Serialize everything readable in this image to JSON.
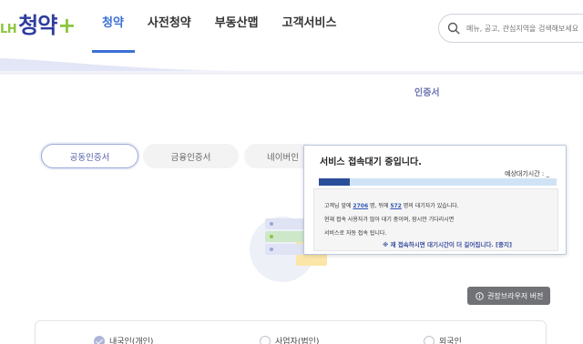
{
  "header": {
    "logo": {
      "prefix": "LH",
      "name": "청약",
      "plus": "+"
    },
    "nav": [
      {
        "label": "청약",
        "active": true
      },
      {
        "label": "사전청약",
        "active": false
      },
      {
        "label": "부동산맵",
        "active": false
      },
      {
        "label": "고객서비스",
        "active": false
      }
    ],
    "search": {
      "placeholder": "메뉴, 공고, 관심지역을 검색해보세요"
    }
  },
  "section": {
    "title": "인증서"
  },
  "cert_tabs": [
    {
      "label": "공동인증서",
      "selected": true
    },
    {
      "label": "금융인증서",
      "selected": false
    },
    {
      "label": "네이버인",
      "selected": false
    }
  ],
  "browser_button": {
    "label": "권장브라우저 버전",
    "icon": "info-icon"
  },
  "user_types": [
    {
      "label": "내국인(개인)",
      "checked": true
    },
    {
      "label": "사업자(법인)",
      "checked": false
    },
    {
      "label": "외국인",
      "checked": false
    }
  ],
  "wait_modal": {
    "title": "서비스 접속대기 중입니다.",
    "expected_label": "예상대기시간 : _",
    "progress": 0.13,
    "line1_prefix": "고객님 앞에 ",
    "ahead_count": "2706",
    "line1_mid": " 명, 뒤에 ",
    "behind_count": "572",
    "line1_suffix": " 명의 대기자가 있습니다.",
    "line2": "현재 접속 사용자가 많아 대기 중이며, 잠시만 기다리시면",
    "line3": "서비스로 자동 접속 됩니다.",
    "note": "※ 재 접속하시면 대기시간이 더 길어집니다. [중지]"
  },
  "colors": {
    "brand_navy": "#2d3c9e",
    "brand_green": "#8cc63e",
    "nav_active": "#3b6fd6",
    "progress_fill": "#2a4e9a",
    "progress_track": "#cfe3f5"
  }
}
